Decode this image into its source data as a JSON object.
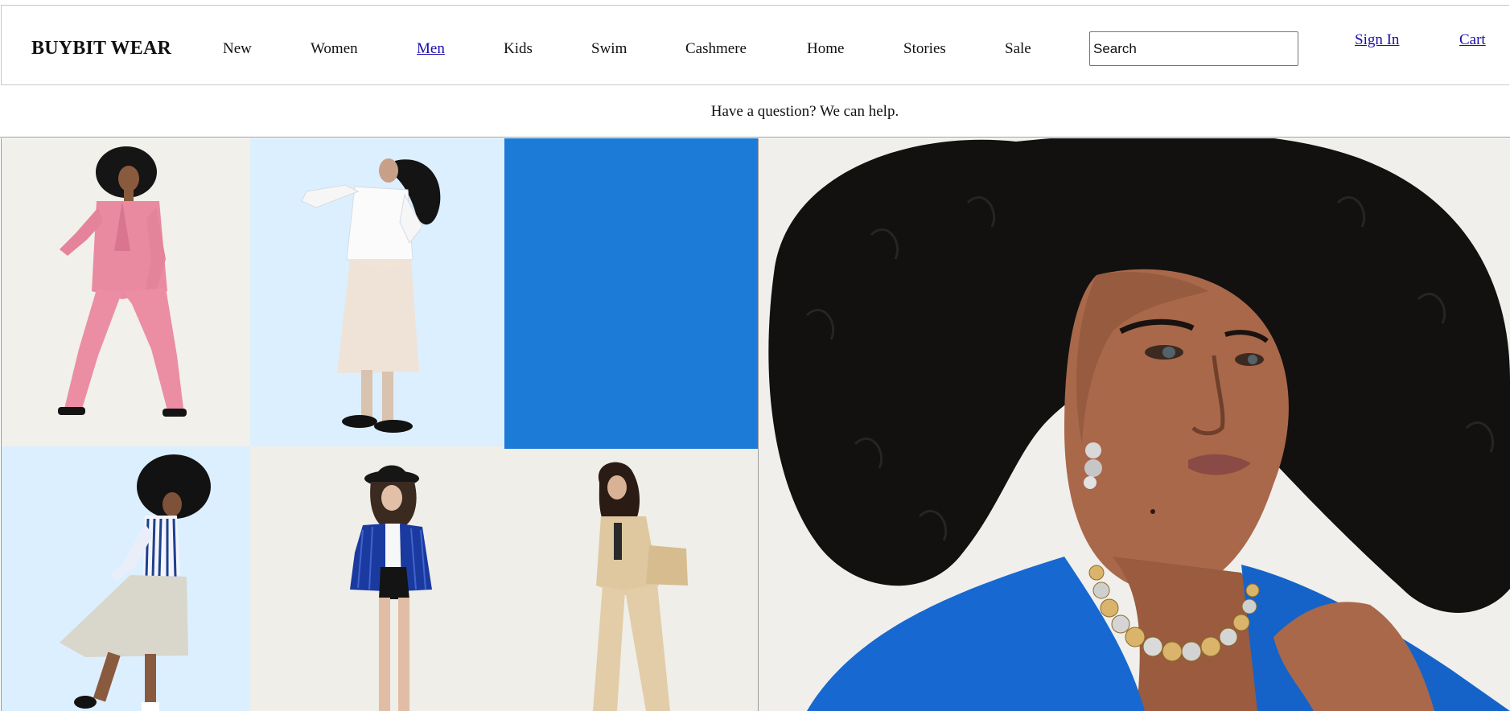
{
  "header": {
    "brand": "BUYBIT WEAR",
    "nav": [
      {
        "label": "New",
        "active": false
      },
      {
        "label": "Women",
        "active": false
      },
      {
        "label": "Men",
        "active": true
      },
      {
        "label": "Kids",
        "active": false
      },
      {
        "label": "Swim",
        "active": false
      },
      {
        "label": "Cashmere",
        "active": false
      },
      {
        "label": "Home",
        "active": false
      },
      {
        "label": "Stories",
        "active": false
      },
      {
        "label": "Sale",
        "active": false
      }
    ],
    "search": {
      "placeholder": "Search",
      "value": ""
    },
    "sign_in": "Sign In",
    "cart": "Cart"
  },
  "help": {
    "text": "Have a question? We can help."
  },
  "colors": {
    "link": "#1a0dab",
    "promo_blue": "#1b7bd6",
    "pink_suit": "#e98aa0",
    "cobalt": "#1768d1",
    "beige": "#dfc8a0"
  },
  "gallery": {
    "tiles": [
      {
        "name": "model-pink-suit",
        "background": "#f1f0ea"
      },
      {
        "name": "model-white-blazer",
        "background": "#dcefff"
      },
      {
        "name": "blue-promo-block",
        "background": "#1b7bd6"
      },
      {
        "name": "model-striped-shirt",
        "background": "#dcefff"
      },
      {
        "name": "model-navy-blazer",
        "background": "#efeee8"
      },
      {
        "name": "model-beige-suit",
        "background": "#efeee8"
      }
    ],
    "hero": {
      "name": "model-portrait-blue-jacket",
      "background": "#f0efeb"
    }
  }
}
